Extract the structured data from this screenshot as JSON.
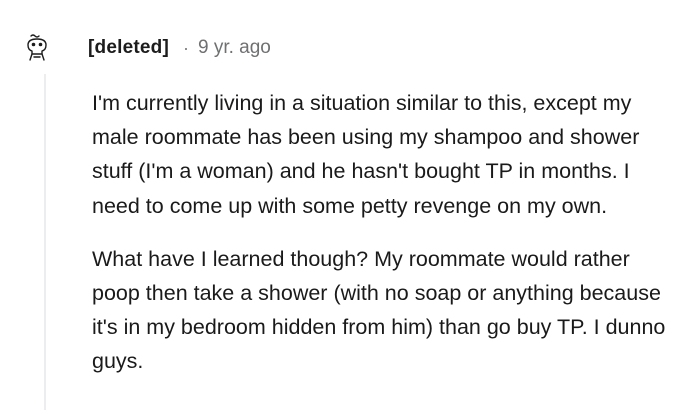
{
  "comment": {
    "author": "[deleted]",
    "separator": "·",
    "timestamp": "9 yr. ago",
    "avatar_icon": "deleted-user-avatar-icon",
    "paragraphs": [
      "I'm currently living in a situation similar to this, except my male roommate has been using my shampoo and shower stuff (I'm a woman) and he hasn't bought TP in months. I need to come up with some petty revenge on my own.",
      "What have I learned though? My roommate would rather poop then take a shower (with no soap or anything because it's in my bedroom hidden from him) than go buy TP. I dunno guys."
    ]
  }
}
